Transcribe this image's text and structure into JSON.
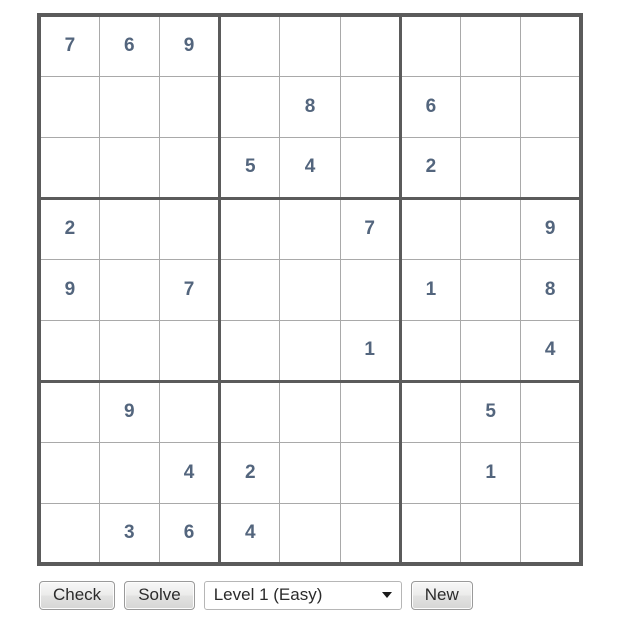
{
  "board": {
    "name": "sudoku-grid",
    "size": 9,
    "empty_cell": "",
    "digit_color": "#53657d",
    "block_line_color": "#5b5b5b",
    "cell_line_color": "#a9a9a9",
    "rows": [
      [
        "7",
        "6",
        "9",
        "",
        "",
        "",
        "",
        "",
        ""
      ],
      [
        "",
        "",
        "",
        "",
        "8",
        "",
        "6",
        "",
        ""
      ],
      [
        "",
        "",
        "",
        "5",
        "4",
        "",
        "2",
        "",
        ""
      ],
      [
        "2",
        "",
        "",
        "",
        "",
        "7",
        "",
        "",
        "9"
      ],
      [
        "9",
        "",
        "7",
        "",
        "",
        "",
        "1",
        "",
        "8"
      ],
      [
        "",
        "",
        "",
        "",
        "",
        "1",
        "",
        "",
        "4"
      ],
      [
        "",
        "9",
        "",
        "",
        "",
        "",
        "",
        "5",
        ""
      ],
      [
        "",
        "",
        "4",
        "2",
        "",
        "",
        "",
        "1",
        ""
      ],
      [
        "",
        "3",
        "6",
        "4",
        "",
        "",
        "",
        "",
        ""
      ]
    ]
  },
  "controls": {
    "check_label": "Check",
    "solve_label": "Solve",
    "new_label": "New",
    "level_select": {
      "selected": "Level 1 (Easy)",
      "options": [
        "Level 1 (Easy)"
      ],
      "caret_icon": "chevron-down-icon"
    }
  }
}
